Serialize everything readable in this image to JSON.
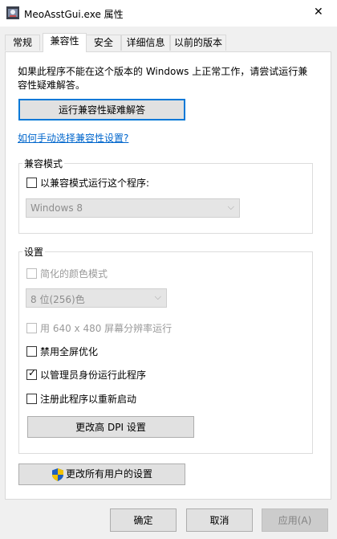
{
  "window": {
    "title": "MeoAsstGui.exe 属性",
    "close_glyph": "✕"
  },
  "tabs": [
    {
      "label": "常规"
    },
    {
      "label": "兼容性"
    },
    {
      "label": "安全"
    },
    {
      "label": "详细信息"
    },
    {
      "label": "以前的版本"
    }
  ],
  "intro": {
    "line1": "如果此程序不能在这个版本的 Windows 上正常工作，请尝试运行兼",
    "line2": "容性疑难解答。"
  },
  "troubleshoot_button": "运行兼容性疑难解答",
  "manual_link": "如何手动选择兼容性设置?",
  "compat_mode": {
    "group_label": "兼容模式",
    "checkbox_label": "以兼容模式运行这个程序:",
    "checked": false,
    "select_value": "Windows 8"
  },
  "settings": {
    "group_label": "设置",
    "reduced_color": {
      "label": "简化的颜色模式",
      "checked": false
    },
    "color_select_value": "8 位(256)色",
    "res_640": {
      "label": "用 640 x 480 屏幕分辨率运行",
      "checked": false
    },
    "disable_fullscreen": {
      "label": "禁用全屏优化",
      "checked": false
    },
    "run_as_admin": {
      "label": "以管理员身份运行此程序",
      "checked": true
    },
    "register_restart": {
      "label": "注册此程序以重新启动",
      "checked": false
    },
    "dpi_button": "更改高 DPI 设置"
  },
  "all_users_button": "更改所有用户的设置",
  "footer": {
    "ok": "确定",
    "cancel": "取消",
    "apply": "应用(A)"
  },
  "check_glyph": "✓",
  "dropdown_glyph": "⌵",
  "colors": {
    "link": "#0066cc",
    "focus": "#0078d7",
    "shield_blue": "#1f5fbf",
    "shield_yellow": "#f2c200"
  }
}
